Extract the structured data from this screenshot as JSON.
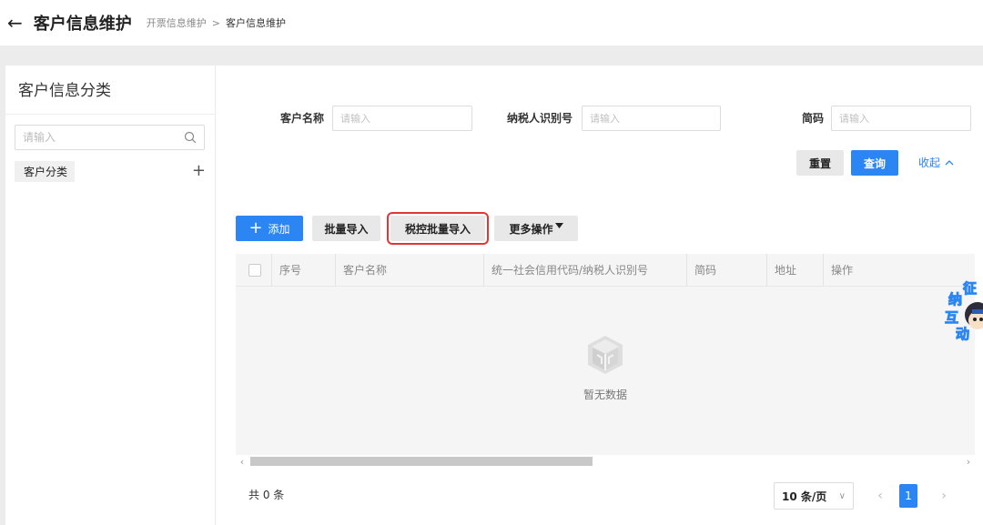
{
  "header": {
    "title": "客户信息维护",
    "breadcrumb_parent": "开票信息维护",
    "breadcrumb_sep": ">",
    "breadcrumb_current": "客户信息维护"
  },
  "sidebar": {
    "title": "客户信息分类",
    "search_placeholder": "请输入",
    "tree_item": "客户分类",
    "add_symbol": "+"
  },
  "filters": {
    "customer_name_label": "客户名称",
    "customer_name_placeholder": "请输入",
    "taxpayer_id_label": "纳税人识别号",
    "taxpayer_id_placeholder": "请输入",
    "short_name_label": "简码",
    "short_name_placeholder": "请输入",
    "reset_label": "重置",
    "query_label": "查询",
    "collapse_label": "收起"
  },
  "toolbar": {
    "add_label": "添加",
    "batch_import_label": "批量导入",
    "tax_batch_import_label": "税控批量导入",
    "more_ops_label": "更多操作"
  },
  "table": {
    "columns": [
      "序号",
      "客户名称",
      "统一社会信用代码/纳税人识别号",
      "简码",
      "地址",
      "操作"
    ],
    "empty_text": "暂无数据"
  },
  "pagination": {
    "total_text": "共 0 条",
    "page_size_label": "10 条/页",
    "current_page": "1"
  },
  "assistant": {
    "chars": [
      "征",
      "纳",
      "互",
      "动"
    ]
  },
  "colors": {
    "primary": "#2b85f3",
    "highlight": "#e23636"
  }
}
